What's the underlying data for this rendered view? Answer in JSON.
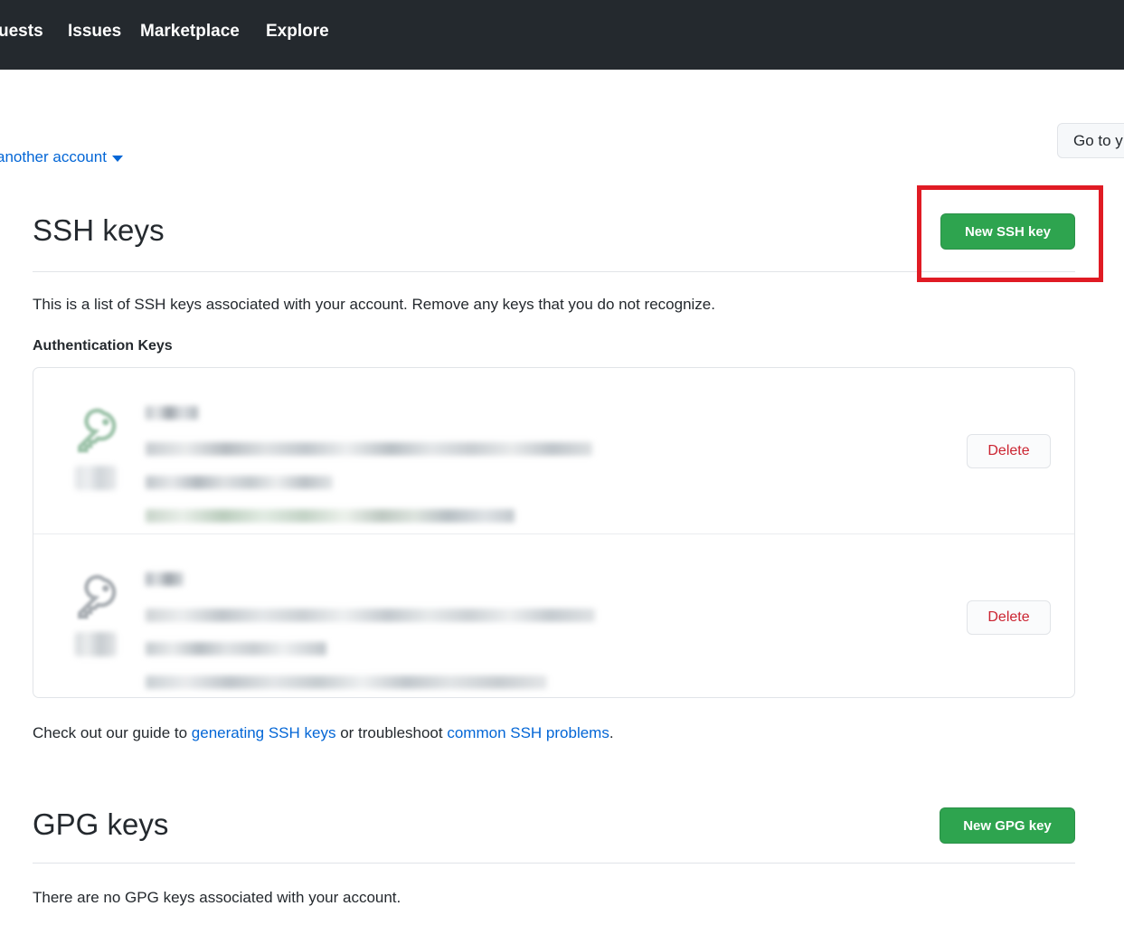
{
  "topnav": {
    "background": "#24292e",
    "links": [
      {
        "label": "uests",
        "name": "nav-pull-requests"
      },
      {
        "label": "Issues",
        "name": "nav-issues"
      },
      {
        "label": "Marketplace",
        "name": "nav-marketplace"
      },
      {
        "label": "Explore",
        "name": "nav-explore"
      }
    ]
  },
  "account_switcher": {
    "label": "another account",
    "icon": "chevron-down-icon",
    "link_color": "#0366d6"
  },
  "goto_button": {
    "label": "Go to y"
  },
  "annotation": {
    "type": "red-highlight-box",
    "color": "#e01b24",
    "target": "new-ssh-key-button"
  },
  "ssh_section": {
    "heading": "SSH keys",
    "new_key_button": "New SSH key",
    "button_color": "#2ea44f",
    "description": "This is a list of SSH keys associated with your account. Remove any keys that you do not recognize.",
    "subheading": "Authentication Keys",
    "keys": [
      {
        "status": "active",
        "icon": "key-icon",
        "icon_color": "#8bb89a",
        "badge_icon": "key-label-badge",
        "title": "[redacted]",
        "fingerprint": "[redacted]",
        "added": "[redacted]",
        "last_used": "[redacted]",
        "delete_label": "Delete"
      },
      {
        "status": "inactive",
        "icon": "key-icon",
        "icon_color": "#9aa0a6",
        "badge_icon": "key-label-badge",
        "title": "[redacted]",
        "fingerprint": "[redacted]",
        "added": "[redacted]",
        "last_used": "[redacted]",
        "delete_label": "Delete"
      }
    ],
    "guide": {
      "prefix": "Check out our guide to ",
      "link1": "generating SSH keys",
      "middle": " or troubleshoot ",
      "link2": "common SSH problems",
      "suffix": "."
    }
  },
  "gpg_section": {
    "heading": "GPG keys",
    "new_key_button": "New GPG key",
    "empty_message": "There are no GPG keys associated with your account."
  }
}
